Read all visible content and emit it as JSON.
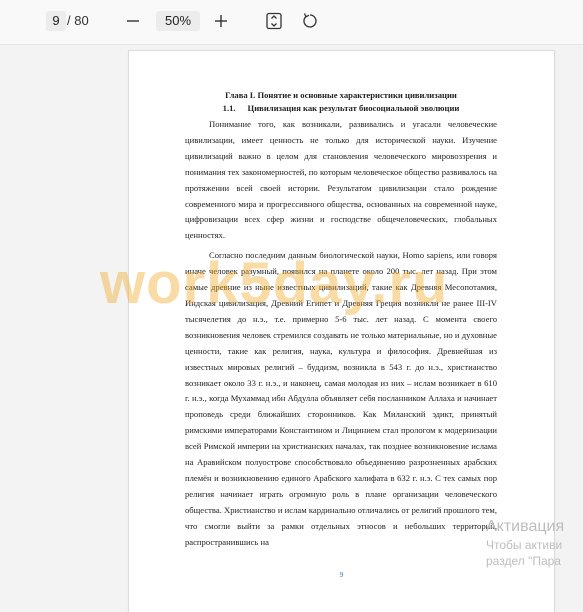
{
  "toolbar": {
    "current_page": "9",
    "total_pages": "/ 80",
    "zoom": "50%",
    "icons": [
      "minus-icon",
      "plus-icon",
      "fit-page-icon",
      "rotate-icon"
    ]
  },
  "document": {
    "chapter_title": "Глава I. Понятие и основные характеристики цивилизации",
    "section_number": "1.1.",
    "section_title": "Цивилизация как результат биосоциальной эволюции",
    "paragraphs": [
      "Понимание того, как возникали, развивались и угасали человеческие цивилизации, имеет ценность не только для исторической науки. Изучение цивилизаций важно в целом для становления человеческого мировоззрения и понимания тех закономерностей, по которым человеческое общество развивалось на протяжении всей своей истории. Результатом цивилизации стало рождение современного мира и прогрессивного общества, основанных на современной науке, цифровизации всех сфер жизни и господстве общечеловеческих, глобальных ценностях.",
      "Согласно последним данным биологической науки, Homo sapiens, или говоря иначе человек разумный, появился на планете около 200 тыс. лет назад. При этом самые древние из ныне известных цивилизаций, такие как Древняя Месопотамия, Индская цивилизация, Древний Египет и Древняя Греция возникли не ранее III-IV тысячелетия до н.э., т.е. примерно 5-6 тыс. лет назад. С момента своего возникновения человек стремился создавать не только материальные, но и духовные ценности, такие как религия, наука, культура и философия. Древнейшая из известных мировых религий – буддизм, возникла в 543 г. до н.э., христианство возникает около 33 г. н.э., и наконец, самая молодая из них – ислам возникает в 610 г. н.э., когда Мухаммад ибн Абдулла объявляет себя посланником Аллаха и начинает проповедь среди ближайших сторонников. Как Миланский эдикт, принятый римскими императорами Константином и Лицинием стал прологом к модернизации всей Римской империи на христианских началах, так позднее возникновение ислама на Аравийском полуострове способствовало объединению разрозненных арабских племён и возникновению единого Арабского халифата в 632 г. н.э. С тех самых пор религия начинает играть огромную роль в плане организации человеческого общества. Христианство и ислам кардинально отличались от религий прошлого тем, что смогли выйти за рамки отдельных этносов и небольших территорий, распространившись на"
    ],
    "page_number": "9"
  },
  "watermark": "work5day.ru",
  "activation": {
    "line1": "Активация",
    "line2": "Чтобы активи",
    "line3": "раздел \"Пара"
  }
}
